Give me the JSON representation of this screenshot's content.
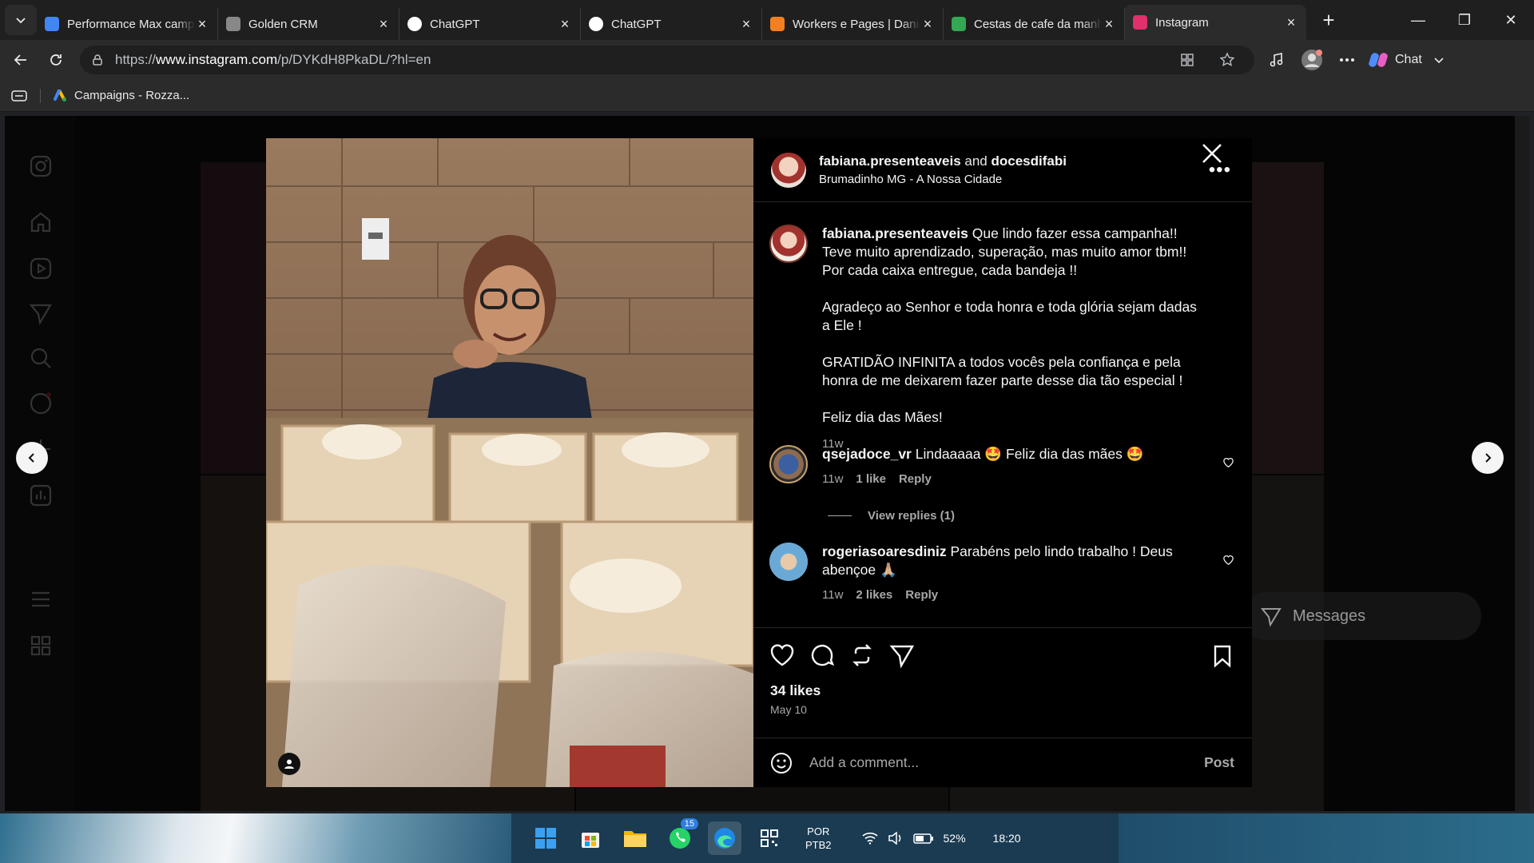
{
  "browser": {
    "tabs": [
      {
        "title": "Performance Max camp",
        "favicon": "google-ads-icon",
        "color": "#4285f4",
        "active": false
      },
      {
        "title": "Golden CRM",
        "favicon": "crm-icon",
        "color": "#888888",
        "active": false
      },
      {
        "title": "ChatGPT",
        "favicon": "openai-icon",
        "color": "#ffffff",
        "active": false
      },
      {
        "title": "ChatGPT",
        "favicon": "openai-icon",
        "color": "#ffffff",
        "active": false
      },
      {
        "title": "Workers e Pages | Danie",
        "favicon": "cloudflare-icon",
        "color": "#f38020",
        "active": false
      },
      {
        "title": "Cestas de cafe da manh",
        "favicon": "maps-pin-icon",
        "color": "#34a853",
        "active": false
      },
      {
        "title": "Instagram",
        "favicon": "instagram-icon",
        "color": "#e1306c",
        "active": true
      }
    ],
    "url_prefix": "https://",
    "url_host": "www.instagram.com",
    "url_path": "/p/DYKdH8PkaDL/?hl=en",
    "chat_label": "Chat",
    "bookmark": "Campaigns - Rozza..."
  },
  "post": {
    "header_user1": "fabiana.presenteaveis",
    "header_and": " and ",
    "header_user2": "docesdifabi",
    "location": "Brumadinho MG - A Nossa Cidade",
    "caption_user": "fabiana.presenteaveis",
    "caption_p1": " Que lindo fazer essa campanha!! Teve muito aprendizado, superação, mas muito amor tbm!! Por cada caixa entregue, cada bandeja !!",
    "caption_p2": "Agradeço ao Senhor e toda honra e toda glória sejam dadas a Ele !",
    "caption_p3": "GRATIDÃO INFINITA a todos vocês pela confiança e pela honra de me deixarem fazer parte desse dia tão especial !",
    "caption_p4": "Feliz dia das Mães!",
    "caption_time": "11w",
    "comments": [
      {
        "user": "qsejadoce_vr",
        "text": " Lindaaaaa 🤩 Feliz dia das mães 🤩",
        "time": "11w",
        "likes": "1 like",
        "reply": "Reply"
      },
      {
        "user": "rogeriasoaresdiniz",
        "text": " Parabéns pelo lindo trabalho ! Deus abençoe 🙏🏼",
        "time": "11w",
        "likes": "2 likes",
        "reply": "Reply"
      }
    ],
    "view_replies": "View replies (1)",
    "likes": "34 likes",
    "date": "May 10",
    "add_comment_placeholder": "Add a comment...",
    "post_label": "Post"
  },
  "background": {
    "messages_label": "Messages"
  },
  "taskbar": {
    "whatsapp_badge": "15",
    "lang_line1": "POR",
    "lang_line2": "PTB2",
    "battery": "52%",
    "time": "18:20"
  }
}
